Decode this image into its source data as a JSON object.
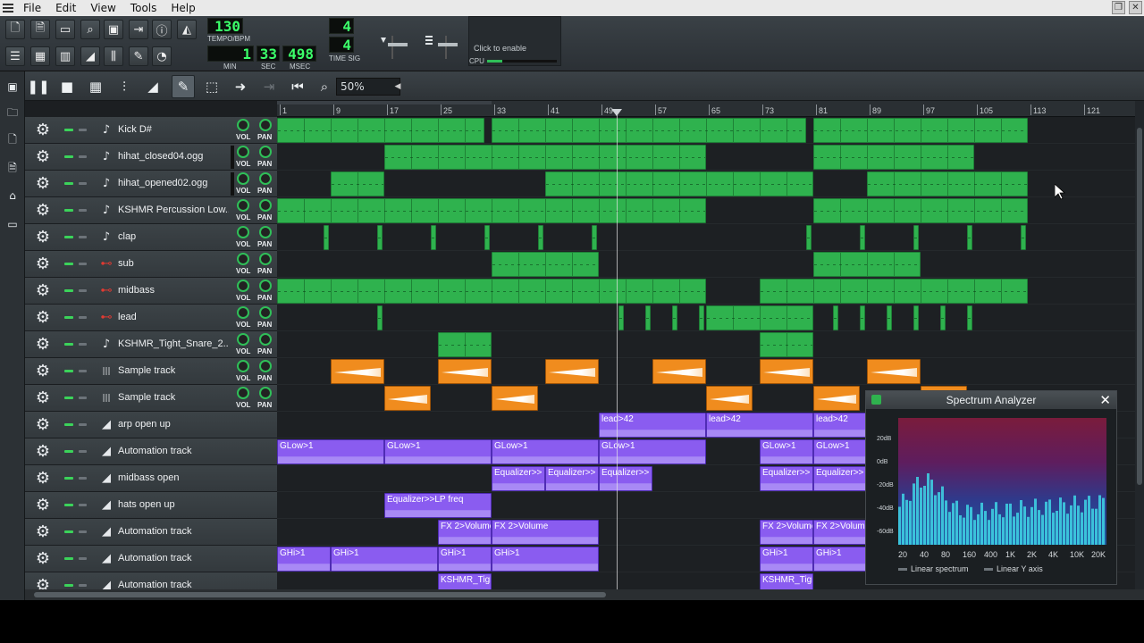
{
  "menubar": {
    "items": [
      "File",
      "Edit",
      "View",
      "Tools",
      "Help"
    ]
  },
  "transport": {
    "tempo": "130",
    "tempo_label": "TEMPO/BPM",
    "min": "1",
    "sec": "33",
    "msec": "498",
    "min_label": "MIN",
    "sec_label": "SEC",
    "msec_label": "MSEC",
    "timesig_top": "4",
    "timesig_bottom": "4",
    "timesig_label": "TIME SIG",
    "cpu_hint": "Click to enable",
    "cpu_label": "CPU"
  },
  "editor": {
    "zoom": "50%"
  },
  "timeline": {
    "bars": [
      "1",
      "9",
      "17",
      "25",
      "33",
      "41",
      "49",
      "57",
      "65",
      "73",
      "81",
      "89",
      "97",
      "105",
      "113",
      "121"
    ]
  },
  "knob_labels": {
    "vol": "VOL",
    "pan": "PAN"
  },
  "tracks": [
    {
      "name": "Kick D#",
      "kind": "instrument",
      "icon": "note-icon"
    },
    {
      "name": "hihat_closed04.ogg",
      "kind": "instrument",
      "icon": "note-icon"
    },
    {
      "name": "hihat_opened02.ogg",
      "kind": "instrument",
      "icon": "note-icon"
    },
    {
      "name": "KSHMR Percussion Low...",
      "kind": "instrument",
      "icon": "note-icon"
    },
    {
      "name": "clap",
      "kind": "instrument",
      "icon": "note-icon"
    },
    {
      "name": "sub",
      "kind": "instrument",
      "icon": "synth-icon"
    },
    {
      "name": "midbass",
      "kind": "instrument",
      "icon": "synth-icon"
    },
    {
      "name": "lead",
      "kind": "instrument",
      "icon": "synth-icon"
    },
    {
      "name": "KSHMR_Tight_Snare_2...",
      "kind": "instrument",
      "icon": "note-icon"
    },
    {
      "name": "Sample track",
      "kind": "sample",
      "icon": "waveform-icon"
    },
    {
      "name": "Sample track",
      "kind": "sample",
      "icon": "waveform-icon"
    },
    {
      "name": "arp open up",
      "kind": "automation",
      "icon": "automation-icon"
    },
    {
      "name": "Automation track",
      "kind": "automation",
      "icon": "automation-icon"
    },
    {
      "name": "midbass open",
      "kind": "automation",
      "icon": "automation-icon"
    },
    {
      "name": "hats open up",
      "kind": "automation",
      "icon": "automation-icon"
    },
    {
      "name": "Automation track",
      "kind": "automation",
      "icon": "automation-icon"
    },
    {
      "name": "Automation track",
      "kind": "automation",
      "icon": "automation-icon"
    },
    {
      "name": "Automation track",
      "kind": "automation",
      "icon": "automation-icon"
    }
  ],
  "automation_clip_labels": {
    "arp": [
      "lead>42",
      "lead>42",
      "lead>42"
    ],
    "glow": [
      "GLow>1",
      "GLow>1",
      "GLow>1",
      "GLow>1",
      "GLow>1",
      "GLow>1"
    ],
    "eq": [
      "Equalizer>>",
      "Equalizer>>",
      "Equalizer>>",
      "Equalizer>>",
      "Equalizer>>"
    ],
    "hats": [
      "Equalizer>>LP freq"
    ],
    "fx": [
      "FX 2>Volume",
      "FX 2>Volume",
      "FX 2>Volume",
      "FX 2>Volume"
    ],
    "ghi": [
      "GHi>1",
      "GHi>1",
      "GHi>1",
      "GHi>1",
      "GHi>1",
      "GHi>1"
    ],
    "snare": [
      "KSHMR_Tigh",
      "KSHMR_Tigh"
    ]
  },
  "spectrum": {
    "title": "Spectrum Analyzer",
    "db_labels": [
      "20dB",
      "0dB",
      "-20dB",
      "-40dB",
      "-60dB"
    ],
    "freq_labels": [
      "20",
      "40",
      "80",
      "160",
      "400",
      "1K",
      "2K",
      "4K",
      "10K",
      "20K"
    ],
    "legend": [
      "Linear spectrum",
      "Linear Y axis"
    ],
    "colors": {
      "bars": "#3fd6e6",
      "bg_top": "#7a1c3c",
      "bg_bottom": "#1e5aa0"
    }
  },
  "colors": {
    "instrument_clip": "#2fb24e",
    "sample_clip": "#f08c1e",
    "automation_clip": "#8a5cf0",
    "lcd_text": "#3bff6a"
  }
}
